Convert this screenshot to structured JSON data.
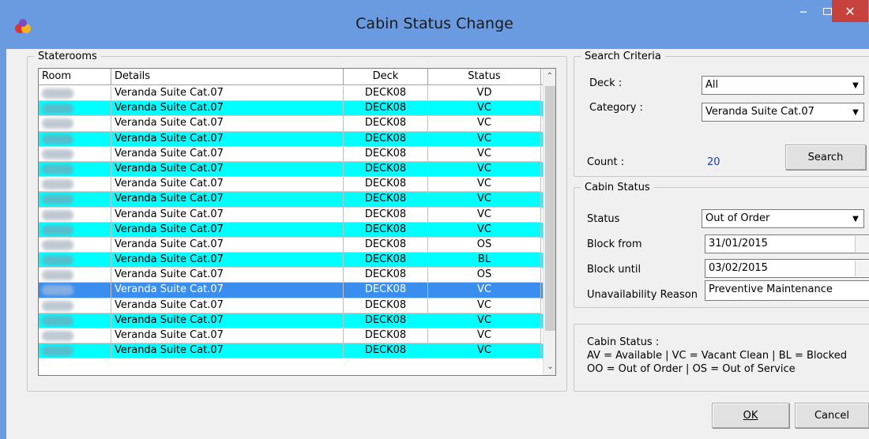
{
  "window": {
    "title": "Cabin Status Change"
  },
  "staterooms": {
    "group_label": "Staterooms",
    "columns": [
      "Room",
      "Details",
      "Deck",
      "Status"
    ],
    "rows": [
      {
        "details": "Veranda Suite Cat.07",
        "deck": "DECK08",
        "status": "VD"
      },
      {
        "details": "Veranda Suite Cat.07",
        "deck": "DECK08",
        "status": "VC"
      },
      {
        "details": "Veranda Suite Cat.07",
        "deck": "DECK08",
        "status": "VC"
      },
      {
        "details": "Veranda Suite Cat.07",
        "deck": "DECK08",
        "status": "VC"
      },
      {
        "details": "Veranda Suite Cat.07",
        "deck": "DECK08",
        "status": "VC"
      },
      {
        "details": "Veranda Suite Cat.07",
        "deck": "DECK08",
        "status": "VC"
      },
      {
        "details": "Veranda Suite Cat.07",
        "deck": "DECK08",
        "status": "VC"
      },
      {
        "details": "Veranda Suite Cat.07",
        "deck": "DECK08",
        "status": "VC"
      },
      {
        "details": "Veranda Suite Cat.07",
        "deck": "DECK08",
        "status": "VC"
      },
      {
        "details": "Veranda Suite Cat.07",
        "deck": "DECK08",
        "status": "VC"
      },
      {
        "details": "Veranda Suite Cat.07",
        "deck": "DECK08",
        "status": "OS"
      },
      {
        "details": "Veranda Suite Cat.07",
        "deck": "DECK08",
        "status": "BL"
      },
      {
        "details": "Veranda Suite Cat.07",
        "deck": "DECK08",
        "status": "OS"
      },
      {
        "details": "Veranda Suite Cat.07",
        "deck": "DECK08",
        "status": "VC"
      },
      {
        "details": "Veranda Suite Cat.07",
        "deck": "DECK08",
        "status": "VC"
      },
      {
        "details": "Veranda Suite Cat.07",
        "deck": "DECK08",
        "status": "VC"
      },
      {
        "details": "Veranda Suite Cat.07",
        "deck": "DECK08",
        "status": "VC"
      },
      {
        "details": "Veranda Suite Cat.07",
        "deck": "DECK08",
        "status": "VC"
      }
    ]
  },
  "search_criteria": {
    "group_label": "Search Criteria",
    "deck_label": "Deck :",
    "deck_value": "All",
    "category_label": "Category :",
    "category_value": "Veranda Suite Cat.07",
    "count_label": "Count :",
    "count_value": "20",
    "search_button": "Search"
  },
  "cabin_status": {
    "group_label": "Cabin Status",
    "status_label": "Status",
    "status_value": "Out of Order",
    "block_from_label": "Block from",
    "block_from_value": "31/01/2015",
    "block_until_label": "Block until",
    "block_until_value": "03/02/2015",
    "reason_label": "Unavailability Reason",
    "reason_value": "Preventive Maintenance"
  },
  "legend": {
    "title": "Cabin Status :",
    "line1": "AV = Available  |  VC = Vacant Clean  |  BL = Blocked",
    "line2": "OO = Out of Order  |  OS = Out of Service"
  },
  "buttons": {
    "ok": "OK",
    "cancel": "Cancel"
  },
  "colors": {
    "alt_row": "#00ffff",
    "selected_row": "#3a8ef0",
    "titlebar": "#6a9be0",
    "close": "#c7423c"
  }
}
